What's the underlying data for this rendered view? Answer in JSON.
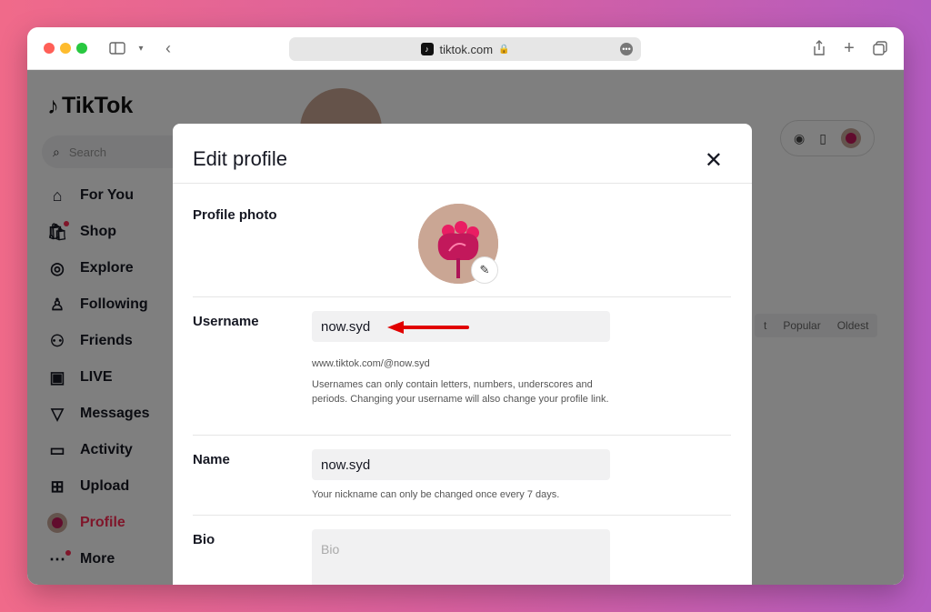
{
  "browser": {
    "url": "tiktok.com",
    "icons": [
      "sidebar-icon",
      "chevron-down-icon",
      "back-icon",
      "lock-icon",
      "more-icon",
      "share-icon",
      "plus-icon",
      "tabs-icon"
    ]
  },
  "app": {
    "logo": "TikTok",
    "search_placeholder": "Search",
    "nav": [
      {
        "label": "For You",
        "icon": "home-icon"
      },
      {
        "label": "Shop",
        "icon": "shop-icon"
      },
      {
        "label": "Explore",
        "icon": "compass-icon"
      },
      {
        "label": "Following",
        "icon": "following-icon"
      },
      {
        "label": "Friends",
        "icon": "friends-icon"
      },
      {
        "label": "LIVE",
        "icon": "live-icon"
      },
      {
        "label": "Messages",
        "icon": "messages-icon"
      },
      {
        "label": "Activity",
        "icon": "activity-icon"
      },
      {
        "label": "Upload",
        "icon": "upload-icon"
      },
      {
        "label": "Profile",
        "icon": "avatar",
        "active": true
      },
      {
        "label": "More",
        "icon": "more-icon"
      }
    ],
    "sort_tabs": [
      "t",
      "Popular",
      "Oldest"
    ],
    "accent_color": "#fe2c55"
  },
  "modal": {
    "title": "Edit profile",
    "profile_photo_label": "Profile photo",
    "username_label": "Username",
    "username_value": "now.syd",
    "username_url": "www.tiktok.com/@now.syd",
    "username_help": "Usernames can only contain letters, numbers, underscores and periods. Changing your username will also change your profile link.",
    "name_label": "Name",
    "name_value": "now.syd",
    "name_help": "Your nickname can only be changed once every 7 days.",
    "bio_label": "Bio",
    "bio_placeholder": "Bio"
  }
}
